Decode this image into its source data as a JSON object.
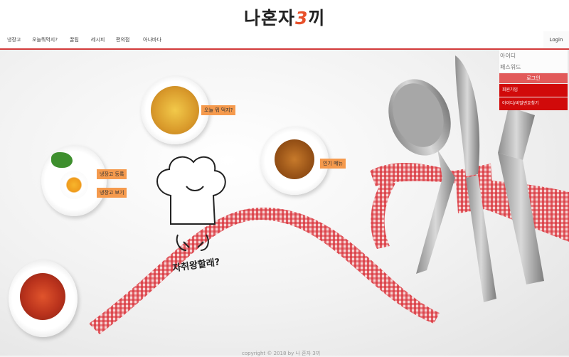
{
  "header": {
    "logo_main": "나혼자",
    "logo_num": "3",
    "logo_tail": "끼"
  },
  "nav": {
    "items": [
      "냉장고",
      "오늘뭐먹지?",
      "꿀팁",
      "레시피",
      "편의점",
      "아나바다"
    ],
    "login": "Login"
  },
  "login_panel": {
    "id_placeholder": "아이디",
    "pw_placeholder": "패스워드",
    "login_button": "로그인",
    "signup_link": "회원가입",
    "find_link": "아이디/비밀번호찾기"
  },
  "tags": {
    "what_to_eat": "오늘 뭐 먹지?",
    "fridge_register": "냉장고 등록",
    "fridge_view": "냉장고 보기",
    "popular_menu": "인기 메뉴"
  },
  "chef_caption": "자취왕할래?",
  "footer": "copyright © 2018 by 나 혼자 3끼",
  "colors": {
    "accent_red": "#d10a0a",
    "tag_orange": "#f59a4d",
    "ribbon": "#d9333a"
  }
}
